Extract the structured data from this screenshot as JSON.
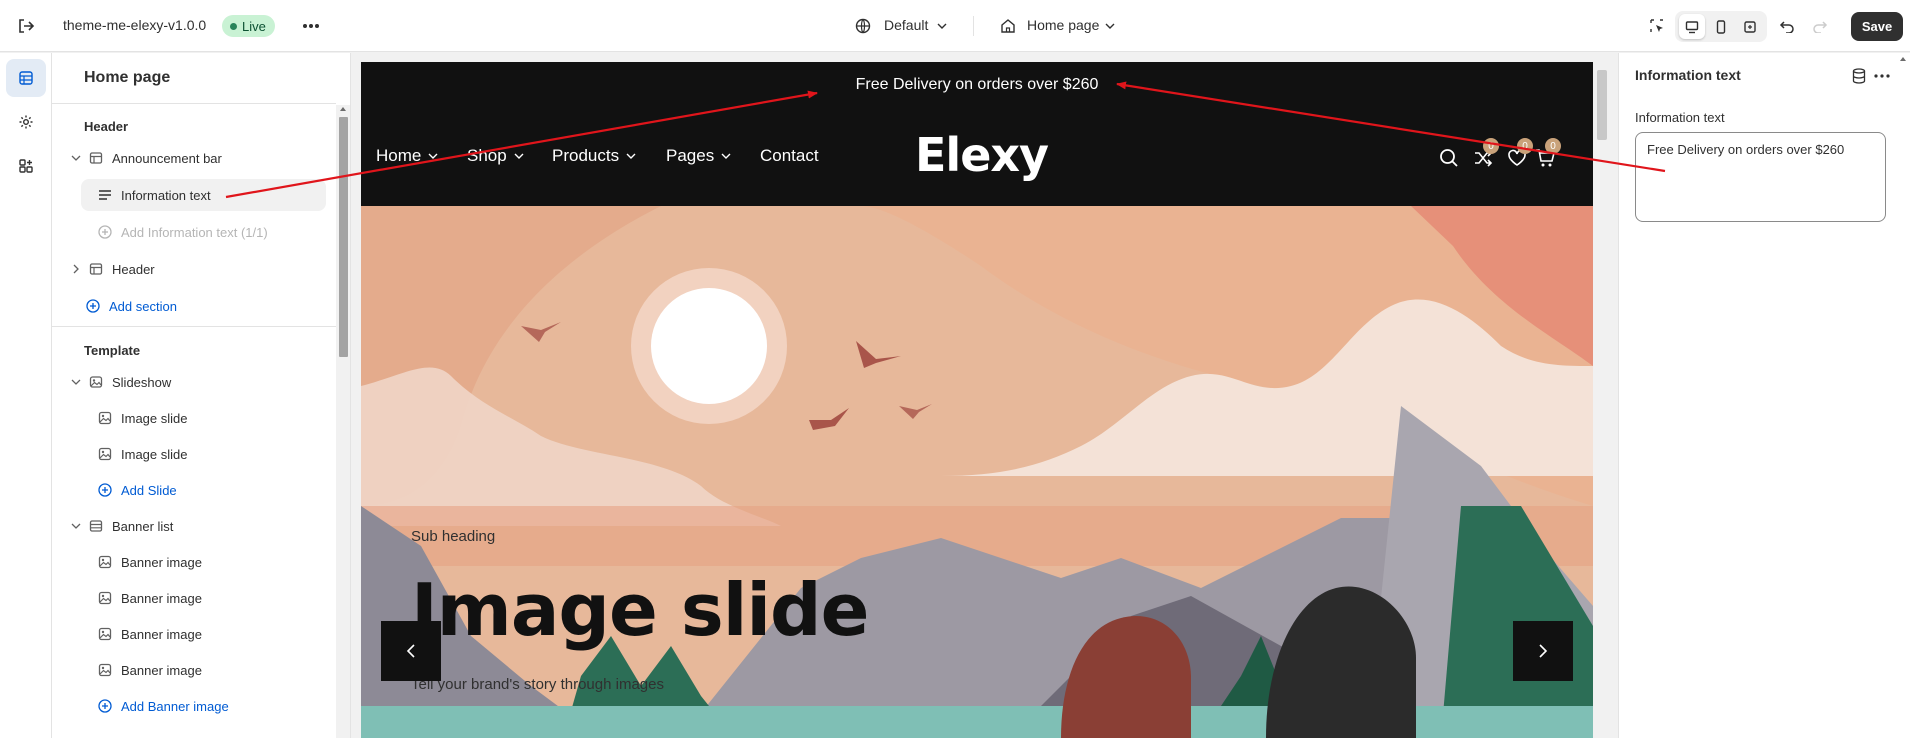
{
  "topbar": {
    "theme_name": "theme-me-elexy-v1.0.0",
    "live_label": "Live",
    "view_select": "Default",
    "page_select": "Home page",
    "save_label": "Save"
  },
  "rail": {
    "items": [
      "sections-icon",
      "settings-icon",
      "apps-icon"
    ]
  },
  "left_panel": {
    "title": "Home page",
    "header_group": {
      "label": "Header",
      "items": [
        {
          "label": "Announcement bar",
          "icon": "section-icon"
        },
        {
          "label": "Information text",
          "icon": "text-block-icon"
        },
        {
          "label": "Add Information text (1/1)",
          "icon": "add-circle-icon"
        },
        {
          "label": "Header",
          "icon": "section-icon"
        },
        {
          "label": "Add section",
          "icon": "add-circle-icon"
        }
      ]
    },
    "template_group": {
      "label": "Template",
      "items": [
        {
          "label": "Slideshow",
          "icon": "slideshow-icon"
        },
        {
          "label": "Image slide",
          "icon": "image-icon"
        },
        {
          "label": "Image slide",
          "icon": "image-icon"
        },
        {
          "label": "Add Slide",
          "icon": "add-circle-icon"
        },
        {
          "label": "Banner list",
          "icon": "section-icon"
        },
        {
          "label": "Banner image",
          "icon": "image-icon"
        },
        {
          "label": "Banner image",
          "icon": "image-icon"
        },
        {
          "label": "Banner image",
          "icon": "image-icon"
        },
        {
          "label": "Banner image",
          "icon": "image-icon"
        },
        {
          "label": "Add Banner image",
          "icon": "add-circle-icon"
        }
      ]
    }
  },
  "preview": {
    "announcement": "Free Delivery on orders over $260",
    "nav": {
      "items": [
        "Home",
        "Shop",
        "Products",
        "Pages",
        "Contact"
      ],
      "logo": "Elexy",
      "badges": [
        "0",
        "0",
        "0"
      ]
    },
    "hero": {
      "sub_heading": "Sub heading",
      "title": "Image slide",
      "text": "Tell your brand's story through images"
    }
  },
  "right_panel": {
    "title": "Information text",
    "field_label": "Information text",
    "field_value": "Free Delivery on orders over $260"
  },
  "colors": {
    "accent": "#005bd3",
    "annotation_arrow": "#e0151b",
    "announcement_bg": "#111111"
  }
}
